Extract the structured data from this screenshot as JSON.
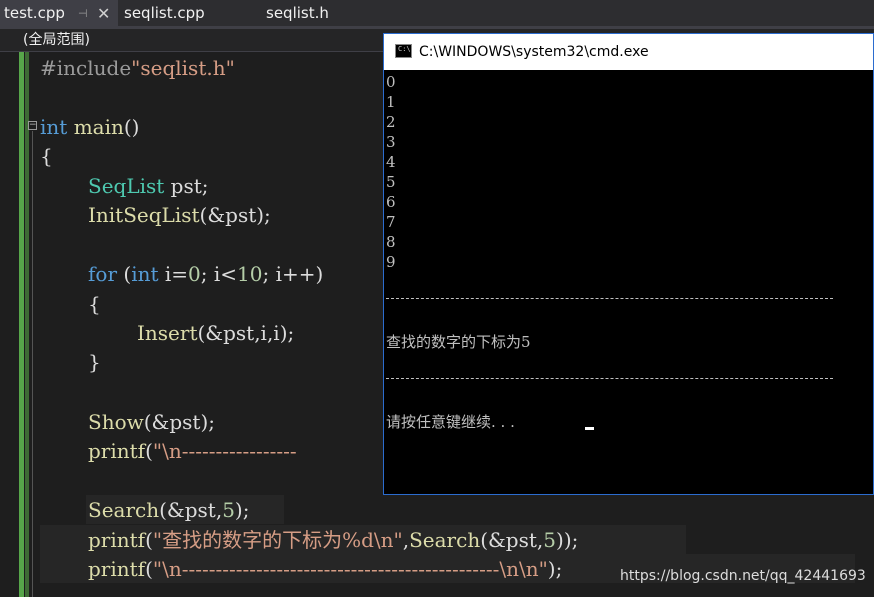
{
  "tabs": [
    {
      "label": "test.cpp",
      "pin": "⊣",
      "close": "✕"
    },
    {
      "label": "seqlist.cpp"
    },
    {
      "label": "seqlist.h"
    }
  ],
  "scope": "(全局范围)",
  "code": {
    "include_directive": "#include",
    "include_file": "\"seqlist.h\"",
    "int_kw": "int",
    "main_name": "main",
    "main_paren": "()",
    "open_brace": "{",
    "type_seqlist": "SeqList",
    "pst_decl": " pst;",
    "init_fn": "InitSeqList",
    "init_args": "(&pst);",
    "for_kw": "for",
    "for_open": " (",
    "for_int": "int",
    "for_i0": " i=",
    "num0": "0",
    "for_mid": "; i<",
    "num10": "10",
    "for_end": "; i++)",
    "inner_open": "{",
    "insert_fn": "Insert",
    "insert_args": "(&pst,i,i);",
    "inner_close": "}",
    "show_fn": "Show",
    "show_args": "(&pst);",
    "printf1_fn": "printf",
    "printf1_open": "(",
    "printf1_str": "\"\\n-----------------",
    "search_fn": "Search",
    "search_args_open": "(&pst,",
    "num5": "5",
    "search_args_close": ");",
    "printf2_fn": "printf",
    "printf2_open": "(",
    "printf2_str": "\"查找的数字的下标为%d\\n\"",
    "printf2_mid": ",",
    "printf2_search": "Search",
    "printf2_args_open": "(&pst,",
    "printf2_num": "5",
    "printf2_close": "));",
    "printf3_fn": "printf",
    "printf3_open": "(",
    "printf3_str": "\"\\n-----------------------------------------------\\n\\n\"",
    "printf3_close": ");"
  },
  "console": {
    "title": "C:\\WINDOWS\\system32\\cmd.exe",
    "icon_text": "C:\\",
    "numbers": [
      "0",
      "1",
      "2",
      "3",
      "4",
      "5",
      "6",
      "7",
      "8",
      "9"
    ],
    "result": "查找的数字的下标为5",
    "prompt": "请按任意键继续. . ."
  },
  "watermark": "https://blog.csdn.net/qq_42441693"
}
